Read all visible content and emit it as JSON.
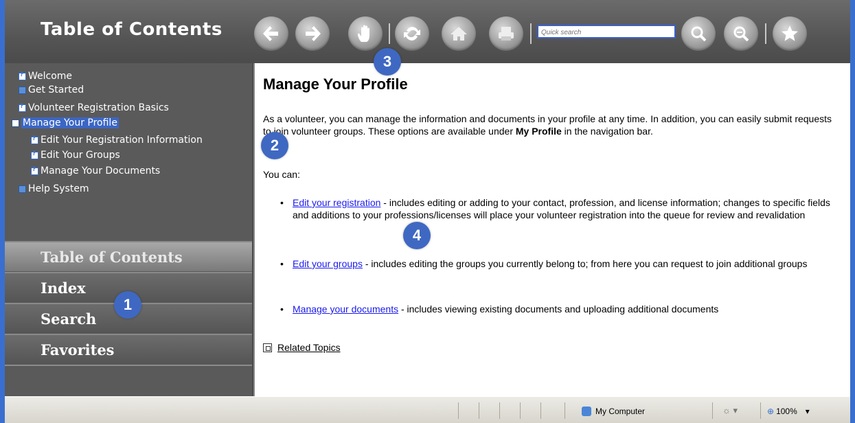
{
  "header": {
    "title": "Table of Contents",
    "quick_search_placeholder": "Quick search"
  },
  "toc": {
    "items": [
      {
        "label": "Welcome",
        "icon": "help-page-icon"
      },
      {
        "label": "Get Started",
        "icon": "book-icon"
      },
      {
        "label": "Volunteer Registration Basics",
        "icon": "help-page-icon"
      },
      {
        "label": "Manage Your Profile",
        "icon": "open-book-icon",
        "selected": true
      },
      {
        "label": "Edit Your Registration Information",
        "icon": "help-page-icon"
      },
      {
        "label": "Edit Your Groups",
        "icon": "help-page-icon"
      },
      {
        "label": "Manage Your Documents",
        "icon": "help-page-icon"
      },
      {
        "label": "Help System",
        "icon": "book-icon"
      }
    ]
  },
  "nav_tabs": {
    "toc": "Table of Contents",
    "index": "Index",
    "search": "Search",
    "favorites": "Favorites"
  },
  "content": {
    "title": "Manage Your Profile",
    "intro_part1": "As a volunteer, you can manage the information and documents in your profile at any time. In addition, you can easily submit requests to join volunteer groups. These options are available under ",
    "intro_bold": "My Profile",
    "intro_part2": " in the navigation bar.",
    "you_can": "You can:",
    "bullets": [
      {
        "link": "Edit your registration",
        "text": " - includes editing or adding to your contact, profession, and license information; changes to specific fields and additions to your professions/licenses will place your volunteer registration into the queue for review and revalidation"
      },
      {
        "link": "Edit your groups",
        "text": " - includes editing the groups you currently belong to; from here you can request to join additional groups"
      },
      {
        "link": "Manage your documents",
        "text": " - includes viewing existing documents and uploading additional documents"
      }
    ],
    "related": "Related Topics"
  },
  "badges": {
    "b1": "1",
    "b2": "2",
    "b3": "3",
    "b4": "4"
  },
  "status": {
    "zone": "My Computer",
    "zoom": "100%"
  },
  "colors": {
    "accent": "#3f68c2",
    "frame": "#3a6fcf",
    "link": "#1a1aee"
  }
}
